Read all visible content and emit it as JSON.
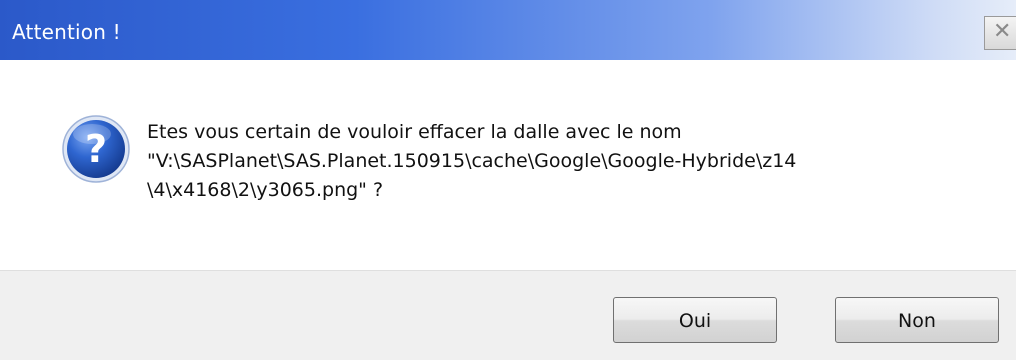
{
  "window": {
    "title": "Attention !",
    "close_glyph": "✕"
  },
  "dialog": {
    "icon": "question-icon",
    "message": "Etes vous certain de vouloir effacer la dalle avec le nom\n\"V:\\SASPlanet\\SAS.Planet.150915\\cache\\Google\\Google-Hybride\\z14\n\\4\\x4168\\2\\y3065.png\" ?"
  },
  "buttons": {
    "yes_label": "Oui",
    "no_label": "Non"
  },
  "colors": {
    "titlebar_start": "#2b59c9",
    "titlebar_end": "#e6edf9",
    "icon_blue": "#1f4fb5",
    "footer_bg": "#f0f0f0"
  }
}
